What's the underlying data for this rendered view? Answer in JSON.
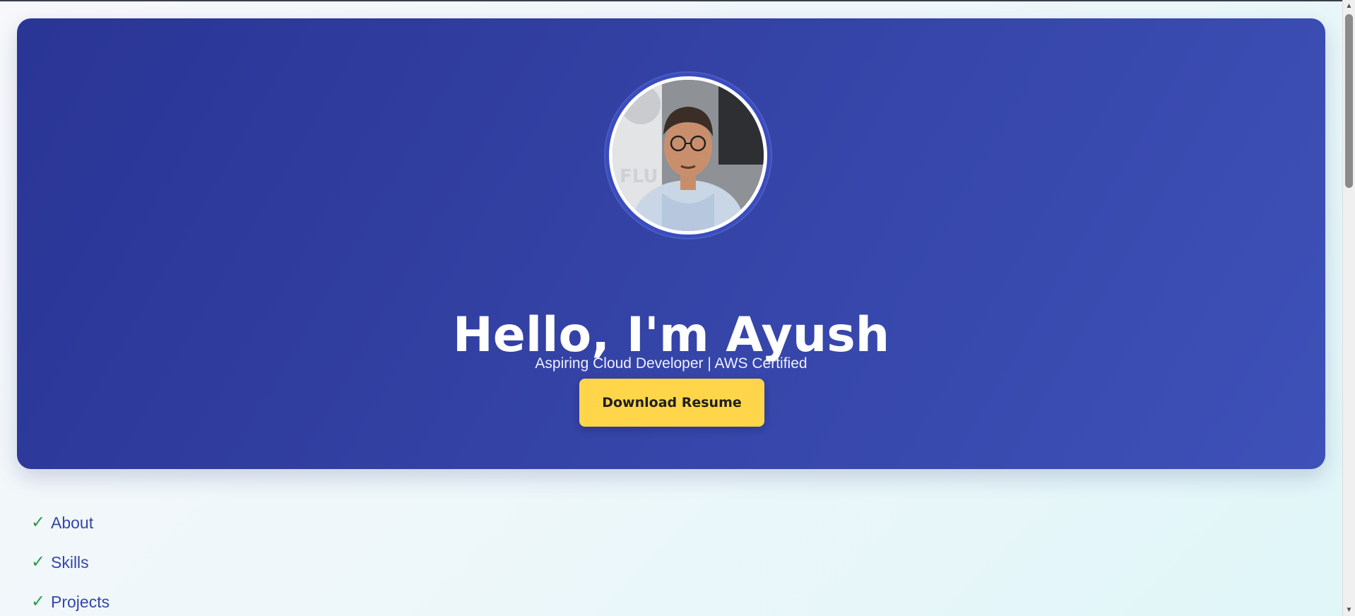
{
  "hero": {
    "title": "Hello, I'm Ayush",
    "subtitle": "Aspiring Cloud Developer | AWS Certified",
    "button_label": "Download Resume"
  },
  "nav": {
    "items": [
      {
        "icon": "check-icon",
        "label": "About"
      },
      {
        "icon": "check-icon",
        "label": "Skills"
      },
      {
        "icon": "check-icon",
        "label": "Projects"
      }
    ]
  },
  "colors": {
    "hero_gradient_start": "#2a3595",
    "hero_gradient_end": "#3e51b8",
    "button_background": "#ffd54a",
    "check_color": "#2f9a4b",
    "link_color": "#3446a8"
  },
  "scrollbar": {
    "up_arrow": "▲",
    "down_arrow": "▼"
  }
}
